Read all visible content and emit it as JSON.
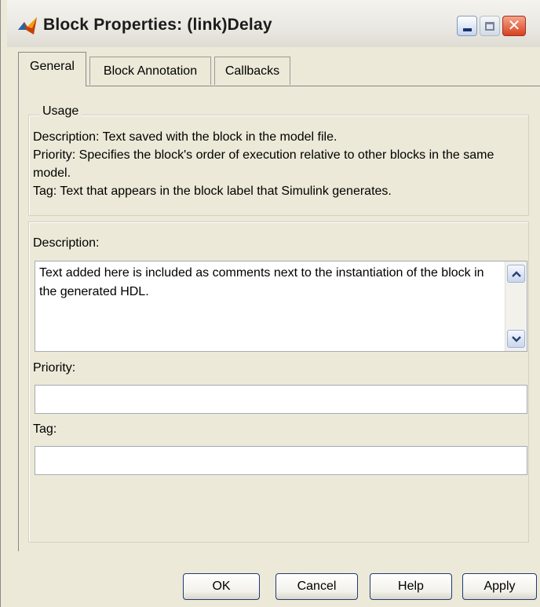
{
  "window": {
    "title": "Block Properties: (link)Delay",
    "controls": {
      "minimize": "_",
      "maximize": "□",
      "close": "✕"
    },
    "icon": "matlab-logo-icon"
  },
  "tabs": [
    {
      "label": "General",
      "active": true
    },
    {
      "label": "Block Annotation",
      "active": false
    },
    {
      "label": "Callbacks",
      "active": false
    }
  ],
  "usage": {
    "legend": "Usage",
    "lines": [
      "Description: Text saved with the block in the model file.",
      "Priority: Specifies the block's order of execution relative to other blocks in the same model.",
      "Tag: Text that appears in the block label that Simulink generates."
    ]
  },
  "fields": {
    "description_label": "Description:",
    "description_value": "Text added here is included as comments next to the instantiation of the block in the generated HDL.",
    "priority_label": "Priority:",
    "priority_value": "",
    "tag_label": "Tag:",
    "tag_value": ""
  },
  "buttons": {
    "ok": "OK",
    "cancel": "Cancel",
    "help": "Help",
    "apply": "Apply"
  }
}
